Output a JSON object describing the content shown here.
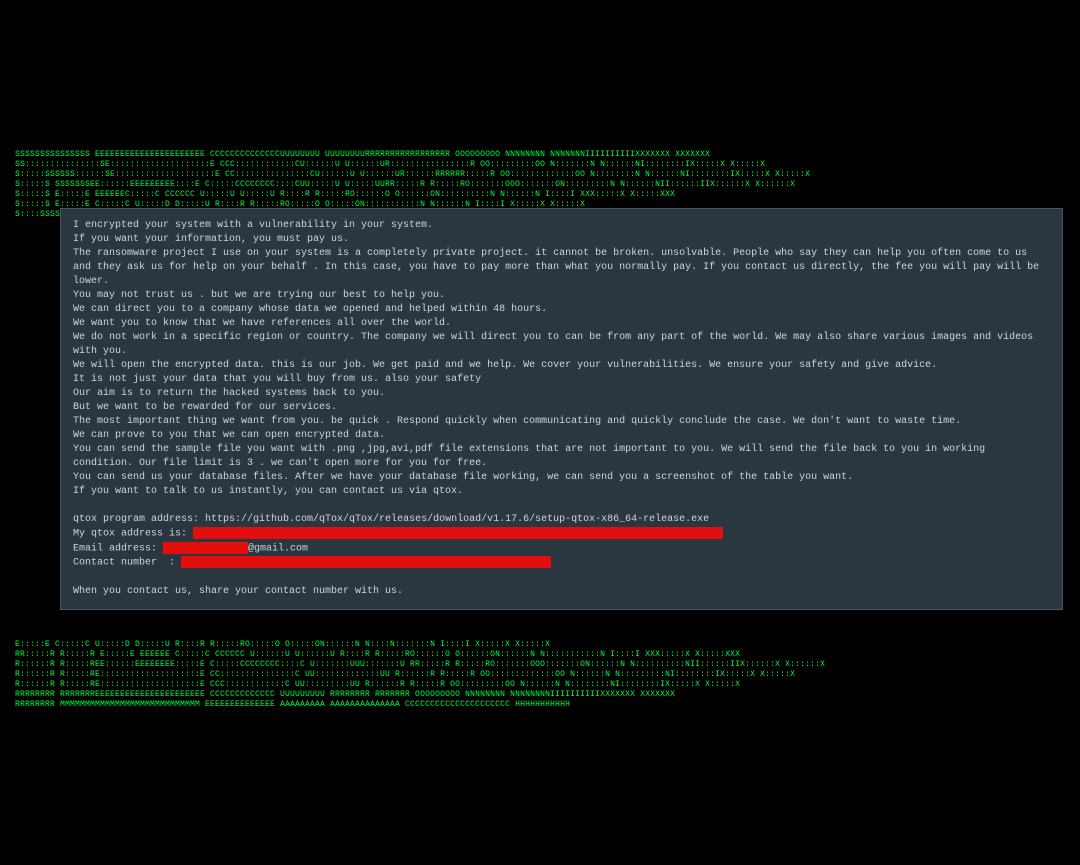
{
  "ascii": {
    "top": [
      "    SSSSSSSSSSSSSSS EEEEEEEEEEEEEEEEEEEEEE       CCCCCCCCCCCCCCUUUUUUUU    UUUUUUUURRRRRRRRRRRRRRRRR       OOOOOOOOO     NNNNNNNN        NNNNNNNIIIIIIIIIIXXXXXXX       XXXXXXX",
      "  SS:::::::::::::::SE::::::::::::::::::::E    CCC::::::::::::CU::::::U    U::::::UR::::::::::::::::R    OO:::::::::OO   N:::::::N       N::::::NI::::::::IX:::::X       X:::::X",
      " S:::::SSSSSS::::::SE::::::::::::::::::::E  CC:::::::::::::::CU::::::U    U::::::UR::::::RRRRRR:::::R OO:::::::::::::OO N::::::::N      N::::::NI::::::::IX:::::X       X:::::X",
      " S:::::S     SSSSSSSEE::::::EEEEEEEEE::::E C:::::CCCCCCCC::::CUU:::::U    U:::::UURR:::::R     R:::::RO:::::::OOO:::::::ON:::::::::N     N::::::NII::::::IIX::::::X     X::::::X",
      " S:::::S              E:::::E       EEEEEEC:::::C       CCCCCC U:::::U    U:::::U   R::::R     R:::::RO::::::O   O::::::ON::::::::::N    N::::::N  I::::I  XXX:::::X   X:::::XXX",
      " S:::::S              E:::::E             C:::::C              U:::::D    D:::::U   R::::R     R:::::RO:::::O     O:::::ON:::::::::::N   N::::::N  I::::I     X:::::X X:::::X",
      "  S::::SSSS           E::::::EEEEEEEEEE   C:::::C              U:::::D    D:::::U   R::::RRRRRR:::::R O:::::O     O:::::ON:::::::N::::N  N::::::N  I::::I      X:::::X:::::X"
    ],
    "bottom": [
      "                      E:::::E             C:::::C              U:::::D    D:::::U   R::::R     R:::::RO:::::O     O:::::ON::::::N  N::::N:::::::N  I::::I     X:::::X X:::::X",
      " RR:::::R     R:::::R  E:::::E       EEEEEE C:::::C       CCCCCC U::::::U    U::::::U   R::::R     R:::::RO::::::O   O::::::ON::::::N   N:::::::::::N  I::::I  XXX:::::X   X:::::XXX",
      " R::::::R     R:::::REE::::::EEEEEEEE:::::E  C:::::CCCCCCCC::::C  U:::::::UUU:::::::U RR:::::R     R:::::RO:::::::OOO:::::::ON::::::N    N::::::::::NII::::::IIX::::::X     X::::::X",
      " R::::::R     R:::::RE::::::::::::::::::::E   CC:::::::::::::::C   UU:::::::::::::UU  R::::::R     R:::::R OO:::::::::::::OO N::::::N     N:::::::::NI::::::::IX:::::X       X:::::X",
      " R::::::R     R:::::RE::::::::::::::::::::E     CCC::::::::::::C     UU:::::::::UU    R::::::R     R:::::R   OO:::::::::OO   N::::::N      N::::::::NI::::::::IX:::::X       X:::::X",
      " RRRRRRRR     RRRRRRREEEEEEEEEEEEEEEEEEEEEE        CCCCCCCCCCCCC       UUUUUUUUU      RRRRRRRR     RRRRRRR     OOOOOOOOO     NNNNNNNN       NNNNNNNNIIIIIIIIIIXXXXXXX       XXXXXXX",
      " RRRRRRRR       MMMMMMMMMMMMMMMMMMMMMMMMMMMM                         EEEEEEEEEEEEEE           AAAAAAAAA                    AAAAAAAAAAAAAA     CCCCCCCCCCCCCCCCCCCCC         HHHHHHHHHHH"
    ]
  },
  "note": {
    "p1": "I encrypted your system with a vulnerability in your system.",
    "p2": "If you want your information, you must pay us.",
    "p3": "The ransomware project I use on your system is a completely private project. it cannot be broken. unsolvable. People who say they can help you often come to us and they ask us for help on your behalf . In this case, you have to pay more than what you normally pay. If you contact us directly, the fee you will pay will be lower.",
    "p4": "You may not trust us . but we are trying our best to help you.",
    "p5": "We can direct you to a company whose data we opened and helped within 48 hours.",
    "p6": "We want you to know that we have references all over the world.",
    "p7": "We do not work in a specific region or country. The company we will direct you to can be from any part of the world. We may also share various images and videos with you.",
    "p8": "We will open the encrypted data. this is our job. We get paid and we help. We cover your vulnerabilities. We ensure your safety and give advice.",
    "p9": "It is not just your data that you will buy from us. also your safety",
    "p10": "Our aim is to return the hacked systems back to you.",
    "p11": "But we want to be rewarded for our services.",
    "p12": "The most important thing we want from you. be quick . Respond quickly when communicating and quickly conclude the case. We don't want to waste time.",
    "p13": "We can prove to you that we can open encrypted data.",
    "p14": "You can send the sample file you want with .png ,jpg,avi,pdf file extensions that are not important to you. We will send the file back to you in working condition. Our file limit is 3 . we can't open more for you for free.",
    "p15": "You can send us your database files. After we have your database file working, we can send you a screenshot of the table you want.",
    "p16": "If you want to talk to us instantly, you can contact us via qtox.",
    "qtox_label": "qtox program address: ",
    "qtox_url": "https://github.com/qTox/qTox/releases/download/v1.17.6/setup-qtox-x86_64-release.exe",
    "qtox_addr_label": "My qtox address is: ",
    "email_label": "Email address: ",
    "email_suffix": "@gmail.com",
    "contact_label": "Contact number  : ",
    "footer": "When you contact us, share your contact number with us."
  }
}
